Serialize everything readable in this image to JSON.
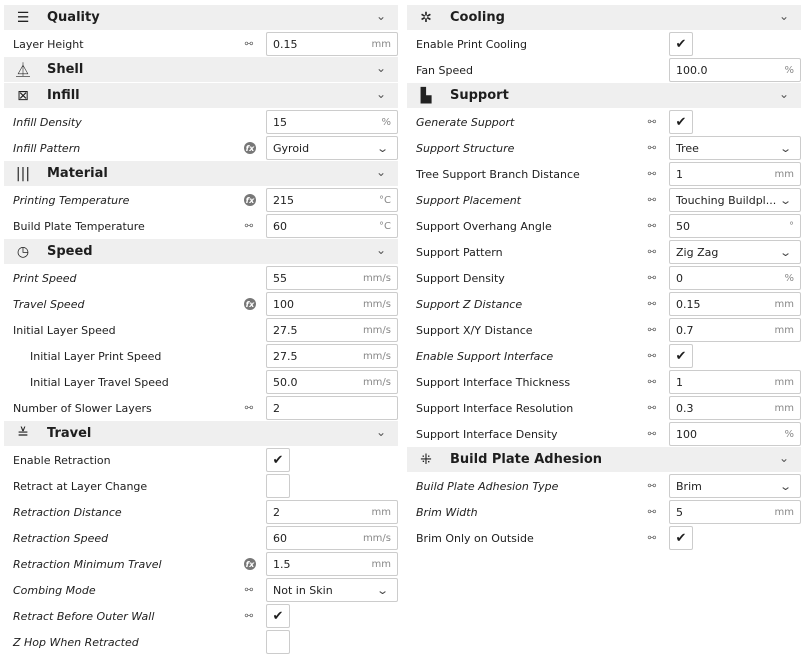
{
  "left": [
    {
      "header": "Quality",
      "icon": "quality-icon",
      "glyph": "☰"
    },
    {
      "label": "Layer Height",
      "link": "link",
      "type": "text",
      "value": "0.15",
      "unit": "mm"
    },
    {
      "header": "Shell",
      "icon": "shell-icon",
      "glyph": "⏅"
    },
    {
      "header": "Infill",
      "icon": "infill-icon",
      "glyph": "⊠"
    },
    {
      "label": "Infill Density",
      "italic": true,
      "type": "text",
      "value": "15",
      "unit": "%"
    },
    {
      "label": "Infill Pattern",
      "italic": true,
      "link": "fx",
      "type": "select",
      "value": "Gyroid"
    },
    {
      "header": "Material",
      "icon": "material-icon",
      "glyph": "|||"
    },
    {
      "label": "Printing Temperature",
      "italic": true,
      "link": "fx",
      "type": "text",
      "value": "215",
      "unit": "°C"
    },
    {
      "label": "Build Plate Temperature",
      "link": "link",
      "type": "text",
      "value": "60",
      "unit": "°C"
    },
    {
      "header": "Speed",
      "icon": "speed-icon",
      "glyph": "◷"
    },
    {
      "label": "Print Speed",
      "italic": true,
      "type": "text",
      "value": "55",
      "unit": "mm/s"
    },
    {
      "label": "Travel Speed",
      "italic": true,
      "link": "fx",
      "type": "text",
      "value": "100",
      "unit": "mm/s"
    },
    {
      "label": "Initial Layer Speed",
      "type": "text",
      "value": "27.5",
      "unit": "mm/s"
    },
    {
      "label": "Initial Layer Print Speed",
      "indent": true,
      "type": "text",
      "value": "27.5",
      "unit": "mm/s"
    },
    {
      "label": "Initial Layer Travel Speed",
      "indent": true,
      "type": "text",
      "value": "50.0",
      "unit": "mm/s"
    },
    {
      "label": "Number of Slower Layers",
      "link": "link",
      "type": "text",
      "value": "2",
      "unit": ""
    },
    {
      "header": "Travel",
      "icon": "travel-icon",
      "glyph": "≚"
    },
    {
      "label": "Enable Retraction",
      "type": "check",
      "checked": true
    },
    {
      "label": "Retract at Layer Change",
      "type": "check",
      "checked": false
    },
    {
      "label": "Retraction Distance",
      "italic": true,
      "type": "text",
      "value": "2",
      "unit": "mm"
    },
    {
      "label": "Retraction Speed",
      "italic": true,
      "type": "text",
      "value": "60",
      "unit": "mm/s"
    },
    {
      "label": "Retraction Minimum Travel",
      "italic": true,
      "link": "fx",
      "type": "text",
      "value": "1.5",
      "unit": "mm"
    },
    {
      "label": "Combing Mode",
      "italic": true,
      "link": "link",
      "type": "select",
      "value": "Not in Skin"
    },
    {
      "label": "Retract Before Outer Wall",
      "italic": true,
      "link": "link",
      "type": "check",
      "checked": true
    },
    {
      "label": "Z Hop When Retracted",
      "italic": true,
      "type": "check",
      "checked": false
    }
  ],
  "right": [
    {
      "header": "Cooling",
      "icon": "cooling-fan-icon",
      "glyph": "✲"
    },
    {
      "label": "Enable Print Cooling",
      "type": "check",
      "checked": true
    },
    {
      "label": "Fan Speed",
      "type": "text",
      "value": "100.0",
      "unit": "%"
    },
    {
      "header": "Support",
      "icon": "support-icon",
      "glyph": "▙"
    },
    {
      "label": "Generate Support",
      "italic": true,
      "link": "link",
      "type": "check",
      "checked": true
    },
    {
      "label": "Support Structure",
      "italic": true,
      "link": "link",
      "type": "select",
      "value": "Tree"
    },
    {
      "label": "Tree Support Branch Distance",
      "link": "link",
      "type": "text",
      "value": "1",
      "unit": "mm"
    },
    {
      "label": "Support Placement",
      "italic": true,
      "link": "link",
      "type": "select",
      "value": "Touching Buildpl..."
    },
    {
      "label": "Support Overhang Angle",
      "link": "link",
      "type": "text",
      "value": "50",
      "unit": "°"
    },
    {
      "label": "Support Pattern",
      "link": "link",
      "type": "select",
      "value": "Zig Zag"
    },
    {
      "label": "Support Density",
      "link": "link",
      "type": "text",
      "value": "0",
      "unit": "%"
    },
    {
      "label": "Support Z Distance",
      "italic": true,
      "link": "link",
      "type": "text",
      "value": "0.15",
      "unit": "mm"
    },
    {
      "label": "Support X/Y Distance",
      "link": "link",
      "type": "text",
      "value": "0.7",
      "unit": "mm"
    },
    {
      "label": "Enable Support Interface",
      "italic": true,
      "link": "link",
      "type": "check",
      "checked": true
    },
    {
      "label": "Support Interface Thickness",
      "link": "link",
      "type": "text",
      "value": "1",
      "unit": "mm"
    },
    {
      "label": "Support Interface Resolution",
      "link": "link",
      "type": "text",
      "value": "0.3",
      "unit": "mm"
    },
    {
      "label": "Support Interface Density",
      "link": "link",
      "type": "text",
      "value": "100",
      "unit": "%"
    },
    {
      "header": "Build Plate Adhesion",
      "icon": "adhesion-icon",
      "glyph": "⁜"
    },
    {
      "label": "Build Plate Adhesion Type",
      "italic": true,
      "link": "link",
      "type": "select",
      "value": "Brim"
    },
    {
      "label": "Brim Width",
      "italic": true,
      "link": "link",
      "type": "text",
      "value": "5",
      "unit": "mm"
    },
    {
      "label": "Brim Only on Outside",
      "link": "link",
      "type": "check",
      "checked": true
    }
  ],
  "glyphs": {
    "check": "✔",
    "chevron": "⌄",
    "link": "⚯",
    "fx": "fx"
  }
}
